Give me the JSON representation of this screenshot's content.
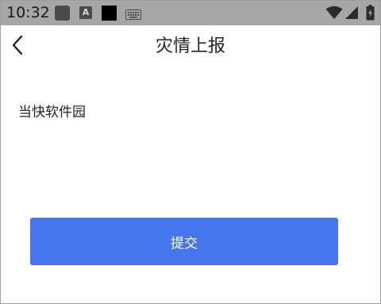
{
  "status_bar": {
    "time": "10:32",
    "badge_letter": "A",
    "icons": [
      "gallery-icon",
      "a-badge-icon",
      "black-square-icon",
      "keyboard-icon",
      "wifi-icon",
      "signal-icon",
      "battery-icon"
    ]
  },
  "header": {
    "title": "灾情上报",
    "back_icon": "chevron-left-icon"
  },
  "content": {
    "report_text": "当快软件园"
  },
  "actions": {
    "submit_label": "提交"
  },
  "colors": {
    "status_bar_bg": "#a6a6a6",
    "accent": "#4676ed",
    "text": "#222222"
  }
}
